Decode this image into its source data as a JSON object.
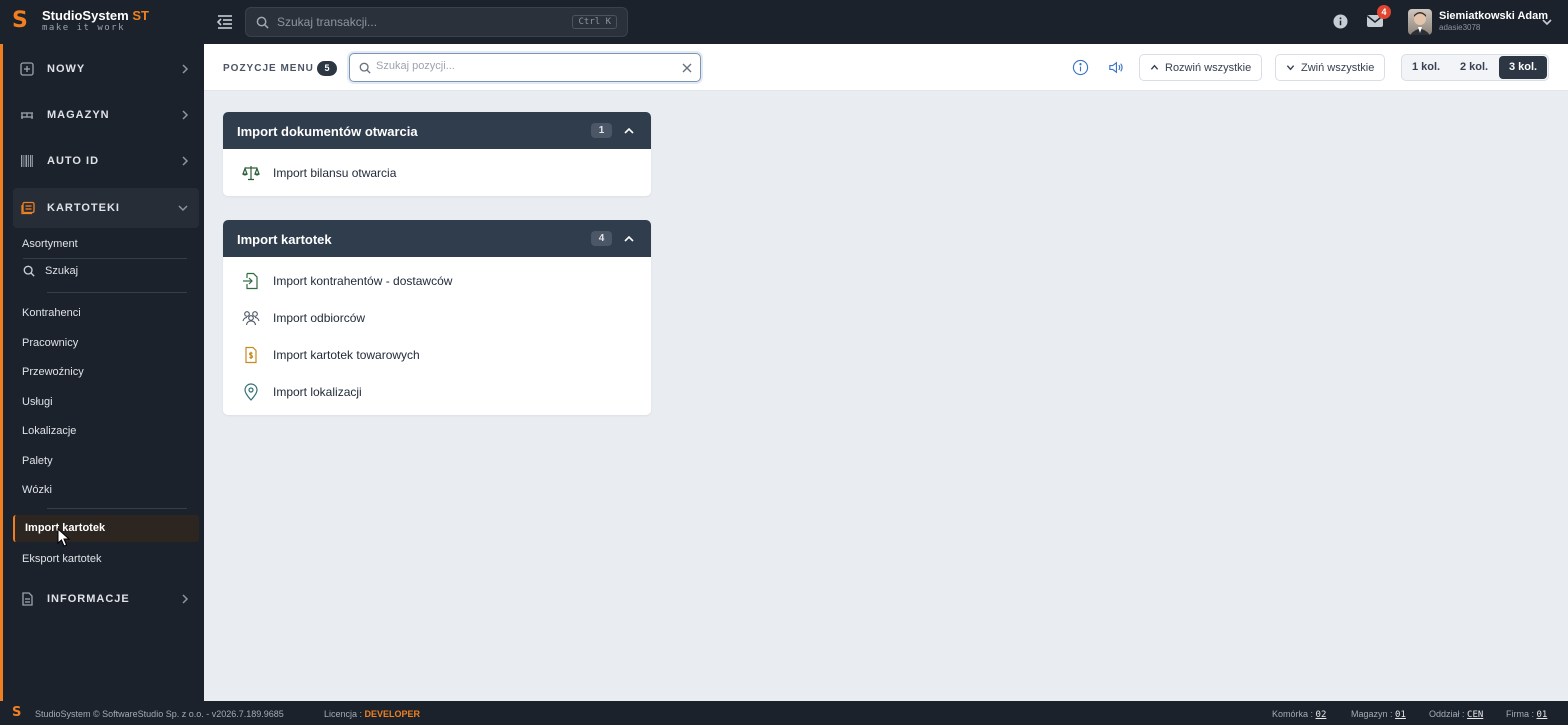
{
  "app": {
    "name": "StudioSystem",
    "name_suffix": "ST",
    "tagline": "make it work"
  },
  "topbar": {
    "search_placeholder": "Szukaj transakcji...",
    "shortcut": "Ctrl K",
    "mail_count": "4",
    "user_name": "Siemiatkowski Adam",
    "user_login": "adasie3078"
  },
  "sidebar": {
    "sections": [
      {
        "label": "NOWY",
        "icon": "plus-square-icon"
      },
      {
        "label": "MAGAZYN",
        "icon": "warehouse-icon"
      },
      {
        "label": "AUTO ID",
        "icon": "barcode-icon"
      },
      {
        "label": "KARTOTEKI",
        "icon": "cards-icon"
      },
      {
        "label": "INFORMACJE",
        "icon": "document-icon"
      }
    ],
    "kartoteki_items": {
      "asortyment": "Asortyment",
      "szukaj": "Szukaj",
      "kontrahenci": "Kontrahenci",
      "pracownicy": "Pracownicy",
      "przewoznicy": "Przewoźnicy",
      "uslugi": "Usługi",
      "lokalizacje": "Lokalizacje",
      "palety": "Palety",
      "wozki": "Wózki",
      "import": "Import kartotek",
      "eksport": "Eksport kartotek"
    }
  },
  "toolbar": {
    "label": "POZYCJE MENU",
    "count": "5",
    "search_placeholder": "Szukaj pozycji...",
    "expand_all": "Rozwiń wszystkie",
    "collapse_all": "Zwiń wszystkie",
    "columns": [
      "1 kol.",
      "2 kol.",
      "3 kol."
    ],
    "selected_columns": "3 kol."
  },
  "groups": [
    {
      "title": "Import dokumentów otwarcia",
      "count": "1",
      "items": [
        {
          "label": "Import bilansu otwarcia",
          "icon": "scale-icon"
        }
      ]
    },
    {
      "title": "Import kartotek",
      "count": "4",
      "items": [
        {
          "label": "Import kontrahentów - dostawców",
          "icon": "file-import-icon"
        },
        {
          "label": "Import odbiorców",
          "icon": "users-icon"
        },
        {
          "label": "Import kartotek towarowych",
          "icon": "file-dollar-icon"
        },
        {
          "label": "Import lokalizacji",
          "icon": "map-pin-icon"
        }
      ]
    }
  ],
  "statusbar": {
    "copyright": "StudioSystem © SoftwareStudio Sp. z o.o. - v2026.7.189.9685",
    "license_label": "Licencja :",
    "license_value": "DEVELOPER",
    "komorka_label": "Komórka :",
    "komorka_value": "02",
    "magazyn_label": "Magazyn :",
    "magazyn_value": "01",
    "oddzial_label": "Oddział :",
    "oddzial_value": "CEN",
    "firma_label": "Firma :",
    "firma_value": "01"
  },
  "colors": {
    "accent": "#f07f22",
    "dark": "#1c222b",
    "card_header": "#2f3d4d"
  }
}
